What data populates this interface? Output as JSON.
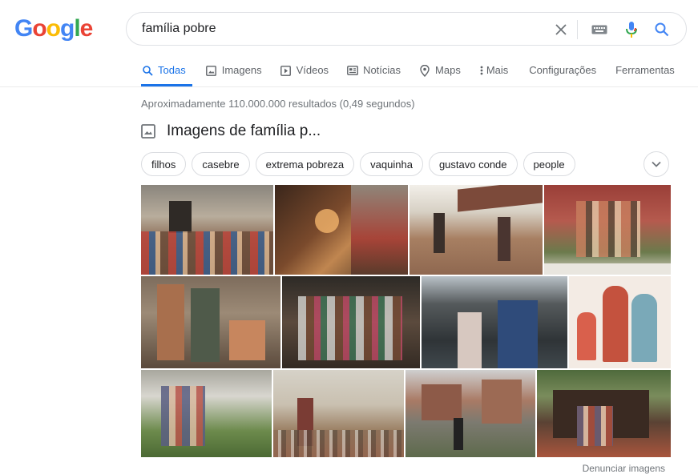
{
  "logo": {
    "letters": [
      "G",
      "o",
      "o",
      "g",
      "l",
      "e"
    ]
  },
  "search": {
    "query": "família pobre"
  },
  "tabs": [
    {
      "label": "Todas",
      "icon": "search-icon"
    },
    {
      "label": "Imagens",
      "icon": "image-icon"
    },
    {
      "label": "Vídeos",
      "icon": "video-icon"
    },
    {
      "label": "Notícias",
      "icon": "news-icon"
    },
    {
      "label": "Maps",
      "icon": "map-pin-icon"
    },
    {
      "label": "Mais",
      "icon": "more-vert-icon"
    },
    {
      "label": "Configurações"
    },
    {
      "label": "Ferramentas"
    }
  ],
  "stats": "Aproximadamente 110.000.000 resultados (0,49 segundos)",
  "images_heading": "Imagens de família p...",
  "chips": [
    "filhos",
    "casebre",
    "extrema pobreza",
    "vaquinha",
    "gustavo conde",
    "people"
  ],
  "report_link": "Denunciar imagens",
  "colors": {
    "blue": "#4285F4",
    "red": "#EA4335",
    "yellow": "#FBBC05",
    "green": "#34A853",
    "active_tab": "#1a73e8"
  }
}
